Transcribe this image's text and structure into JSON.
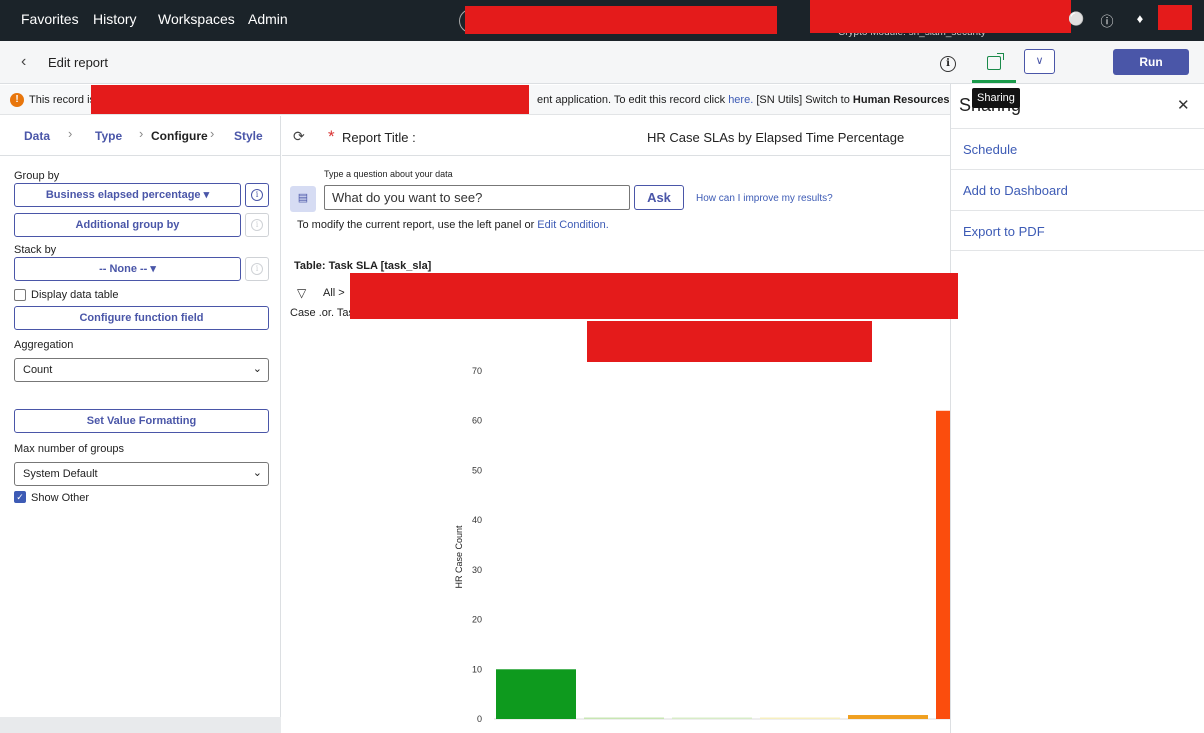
{
  "topnav": {
    "favorites": "Favorites",
    "history": "History",
    "workspaces": "Workspaces",
    "admin": "Admin",
    "module_text": "Crypto Module: sn_slam_security"
  },
  "subheader": {
    "back_label": "Edit report",
    "run_label": "Run"
  },
  "alert": {
    "left_text": "This record is",
    "right_text_1": "ent application. To edit this record click ",
    "here_link": "here.",
    "right_text_2": " [SN Utils] Switch to ",
    "bold_text": "Human Resources: C"
  },
  "sharing": {
    "title": "Sharing",
    "tooltip": "Sharing",
    "items": [
      "Schedule",
      "Add to Dashboard",
      "Export to PDF"
    ]
  },
  "tabs": [
    "Data",
    "Type",
    "Configure",
    "Style"
  ],
  "config": {
    "group_by_label": "Group by",
    "group_by_value": "Business elapsed percentage",
    "additional_group_by": "Additional group by",
    "stack_by_label": "Stack by",
    "stack_by_value": "-- None --",
    "display_data_table": "Display data table",
    "configure_function_field": "Configure function field",
    "aggregation_label": "Aggregation",
    "aggregation_value": "Count",
    "set_value_formatting": "Set Value Formatting",
    "max_groups_label": "Max number of groups",
    "max_groups_value": "System Default",
    "show_other": "Show Other"
  },
  "report": {
    "title_label": "Report Title :",
    "title_value": "HR Case SLAs by Elapsed Time Percentage",
    "ask_hint": "Type a question about your data",
    "ask_placeholder": "What do you want to see?",
    "ask_button": "Ask",
    "improve_link": "How can I improve my results?",
    "modify_text": "To modify the current report, use the left panel or ",
    "edit_condition": "Edit Condition.",
    "table_label": "Table: Task SLA [task_sla]",
    "filter_all": "All >",
    "case_or": "Case .or. Tas"
  },
  "chart_data": {
    "type": "bar",
    "ylabel": "HR Case Count",
    "ylim": [
      0,
      70
    ],
    "yticks": [
      0,
      10,
      20,
      30,
      40,
      50,
      60,
      70
    ],
    "values": [
      10,
      0.3,
      0.3,
      0.3,
      0.8,
      62
    ],
    "colors": [
      "#0e9a1e",
      "#c8e6b4",
      "#d8ecc8",
      "#f6efc0",
      "#f0a020",
      "#fb4d0d"
    ]
  }
}
